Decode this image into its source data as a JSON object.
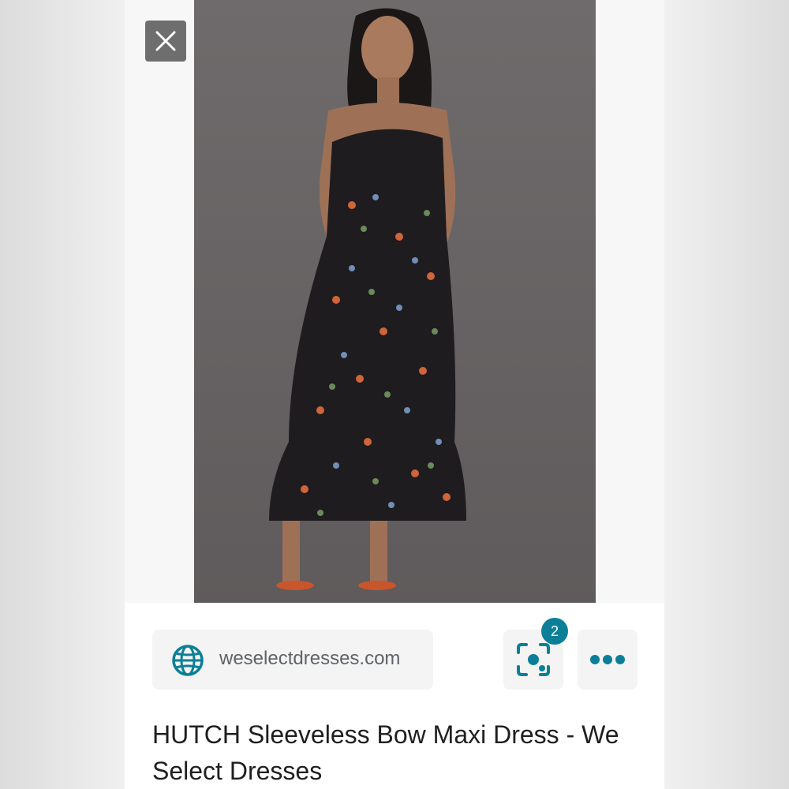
{
  "viewer": {
    "close_icon": "close-icon",
    "image_alt": "Model wearing black floral maxi dress"
  },
  "source": {
    "icon": "globe-icon",
    "domain": "weselectdresses.com"
  },
  "actions": {
    "lens_icon": "lens-camera-icon",
    "lens_badge": "2",
    "more_icon": "more-dots-icon"
  },
  "result": {
    "title": "HUTCH Sleeveless Bow Maxi Dress - We Select Dresses"
  },
  "colors": {
    "accent": "#0b7f98",
    "chip_bg": "#f4f4f4",
    "photo_bg": "#6f6b6c"
  }
}
